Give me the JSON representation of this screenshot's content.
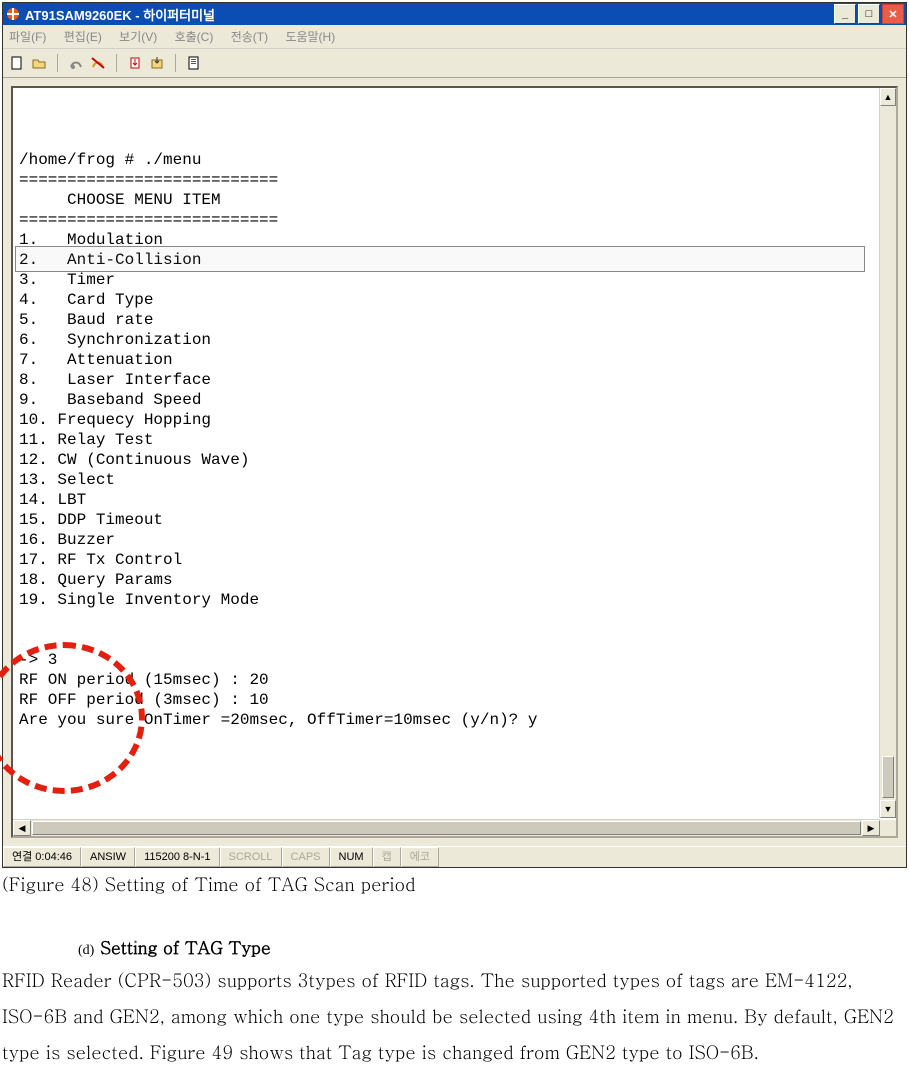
{
  "window": {
    "title": "AT91SAM9260EK - 하이퍼터미널"
  },
  "menubar": {
    "file": "파일(F)",
    "edit": "편집(E)",
    "view": "보기(V)",
    "call": "호출(C)",
    "transfer": "전송(T)",
    "help": "도움말(H)"
  },
  "terminal": {
    "lines": [
      "",
      "",
      "",
      "/home/frog # ./menu",
      "===========================",
      "     CHOOSE MENU ITEM",
      "===========================",
      "1.   Modulation",
      "2.   Anti-Collision",
      "3.   Timer",
      "4.   Card Type",
      "5.   Baud rate",
      "6.   Synchronization",
      "7.   Attenuation",
      "8.   Laser Interface",
      "9.   Baseband Speed",
      "10. Frequecy Hopping",
      "11. Relay Test",
      "12. CW (Continuous Wave)",
      "13. Select",
      "14. LBT",
      "15. DDP Timeout",
      "16. Buzzer",
      "17. RF Tx Control",
      "18. Query Params",
      "19. Single Inventory Mode",
      "",
      "",
      "-> 3",
      "RF ON period (15msec) : 20",
      "RF OFF period (3msec) : 10",
      "Are you sure OnTimer =20msec, OffTimer=10msec (y/n)? y"
    ]
  },
  "statusbar": {
    "conn": "연결 0:04:46",
    "emu": "ANSIW",
    "port": "115200 8-N-1",
    "scroll": "SCROLL",
    "caps": "CAPS",
    "num": "NUM",
    "cap": "캡",
    "echo": "에코"
  },
  "document": {
    "caption": "(Figure 48) Setting of Time of TAG Scan period",
    "section_marker": "(d)",
    "section_title": "Setting of TAG Type",
    "paragraph": "RFID Reader (CPR-503) supports 3types of RFID tags. The supported types of tags are EM-4122, ISO-6B and GEN2, among which one type should be selected using 4th item in menu. By default, GEN2 type is selected. Figure 49 shows that Tag type is changed from GEN2 type to ISO-6B."
  }
}
